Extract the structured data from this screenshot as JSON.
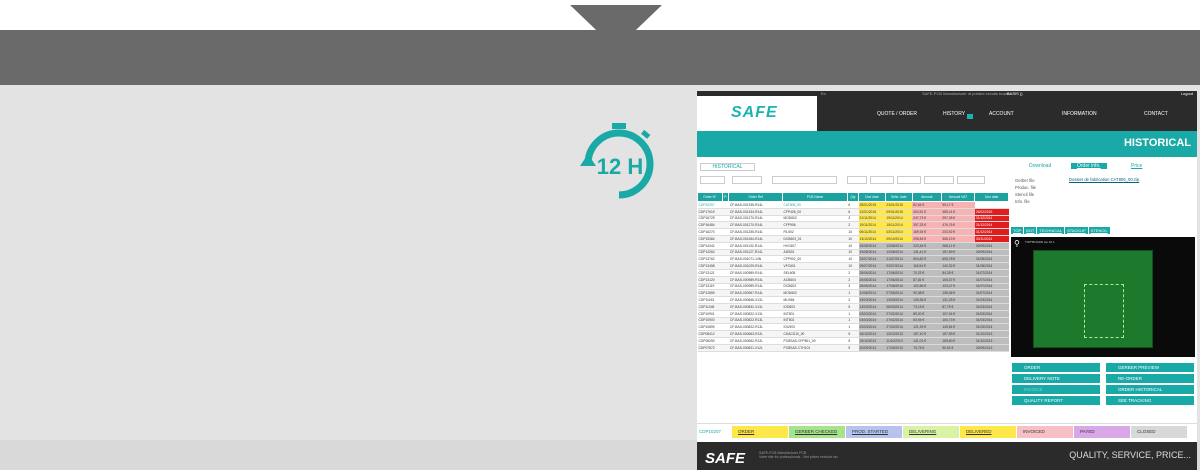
{
  "screenshot": {
    "lang": "En",
    "top_title": "SAFE-PCB Manufacturer of printed circuits board",
    "user": "BASIS ()",
    "logout": "Logout",
    "logo": "SAFE",
    "nav": [
      "QUOTE / ORDER",
      "HISTORY",
      "ACCOUNT",
      "INFORMATION",
      "CONTACT"
    ],
    "page_title": "HISTORICAL",
    "history_tab": "HISTORICAL",
    "columns": [
      "Order N°",
      "P.",
      "Order Ref",
      "PCB Name",
      "Qty",
      "Due date",
      "Sello. date",
      "Amount",
      "Amount VAT",
      "Due date"
    ],
    "rows": [
      [
        "CDP10207",
        "CF-BAS-001335-R14L",
        "CAT806_00",
        "6",
        "28/01/2015",
        "23/01/2015",
        "82,64 €",
        "99,17 €",
        ""
      ],
      [
        "CDP17619",
        "CF-BAS-001334-R14L",
        "CFP405_00",
        "6",
        "12/01/2015",
        "09/01/2015",
        "404,51 €",
        "485,41 €",
        "26/02/2015"
      ],
      [
        "CDP16729",
        "CF-BAS-001270-R14L",
        "MOD602",
        "3",
        "21/11/2014",
        "19/11/2014",
        "247,73 €",
        "297,28 €",
        "31/12/2014"
      ],
      [
        "CDP16484",
        "CF-BAS-001270-R14L",
        "CFP906",
        "2",
        "19/11/2014",
        "15/11/2014",
        "397,33 €",
        "476,76 €",
        "31/12/2014"
      ],
      [
        "CDP16270",
        "CF-BAS-001255-R14L",
        "FIL502",
        "10",
        "06/11/2014",
        "03/11/2014",
        "169,94 €",
        "203,92 €",
        "31/12/2014"
      ],
      [
        "CDP15384",
        "CF-BAS-001264-R14L",
        "DCB603_01",
        "10",
        "13/10/2014",
        "09/10/2014",
        "298,83 €",
        "358,19 €",
        "30/11/2014"
      ],
      [
        "CDP14342",
        "CF-BAS-001132-R14L",
        "HVC607",
        "10",
        "16/08/2014",
        "13/08/2014",
        "223,45 €",
        "268,11 €",
        "30/09/2014"
      ],
      [
        "CDP14264",
        "CF-BAS-001127-R14L",
        "AID501",
        "10",
        "19/08/2014",
        "13/08/2014",
        "131,41 €",
        "157,69 €",
        "30/09/2014"
      ],
      [
        "CDP13762",
        "CF-BAS-001071-14N",
        "CFP902_00",
        "10",
        "23/07/2014",
        "21/07/2014",
        "504,82 €",
        "605,78 €",
        "31/08/2014"
      ],
      [
        "CDP13458",
        "CF-BAS-001029-R14L",
        "VFC601",
        "10",
        "09/07/2014",
        "03/07/2014",
        "116,94 €",
        "140,32 €",
        "31/08/2014"
      ],
      [
        "CDP13121",
        "CF-BAS-000989-R14L",
        "SEL605",
        "2",
        "25/06/2014",
        "17/06/2014",
        "70,23 €",
        "84,28 €",
        "31/07/2014"
      ],
      [
        "CDP13120",
        "CF-BAS-000989-R14L",
        "ACB604",
        "2",
        "20/06/2014",
        "17/06/2014",
        "87,81 €",
        "105,37 €",
        "31/07/2014"
      ],
      [
        "CDP13119",
        "CF-BAS-000989-R14L",
        "DCB603",
        "3",
        "25/06/2014",
        "17/06/2014",
        "102,56 €",
        "123,07 €",
        "31/07/2014"
      ],
      [
        "CDP12859",
        "CF-BAS-000967-R14L",
        "MOD602",
        "1",
        "11/06/2014",
        "07/06/2014",
        "90,38 €",
        "108,46 €",
        "31/07/2014"
      ],
      [
        "CDP11163",
        "CF-BAS-000846-X13L",
        "MLI984",
        "2",
        "19/03/2014",
        "13/03/2014",
        "109,38 €",
        "131,25 €",
        "31/03/2014"
      ],
      [
        "CDP11045",
        "CF-BAS-000832-X13L",
        "IOD803",
        "5",
        "13/03/2014",
        "06/03/2014",
        "73,15 €",
        "87,78 €",
        "31/03/2014"
      ],
      [
        "CDP10901",
        "CF-BAS-000822-X13L",
        "INT801",
        "1",
        "03/03/2014",
        "27/02/2014",
        "89,20 €",
        "107,04 €",
        "31/03/2014"
      ],
      [
        "CDP10900",
        "CF-BAS-000822-R13L",
        "INT802",
        "1",
        "03/03/2014",
        "27/02/2014",
        "83,94 €",
        "100,73 €",
        "31/03/2014"
      ],
      [
        "CDP10899",
        "CF-BAS-000822-R13L",
        "IOU903",
        "1",
        "03/03/2014",
        "27/02/2014",
        "121,29 €",
        "145,54 €",
        "31/03/2014"
      ],
      [
        "CDP08412",
        "CF-BAS-000663-R12L",
        "CDACD10_00",
        "5",
        "16/10/2013",
        "13/10/2013",
        "157,10 €",
        "187,89 €",
        "31/10/2013"
      ],
      [
        "CDP08250",
        "CF-BAS-000652-R12L",
        "PCBSAS-CFP801_00",
        "5",
        "15/10/2013",
        "11/10/2013",
        "141,01 €",
        "169,60 €",
        "31/10/2013"
      ],
      [
        "CDP07872",
        "CF-BAS-000621-X12L",
        "PCBSAS-CTH101",
        "5",
        "20/09/2013",
        "17/09/2013",
        "75,75 €",
        "90,50 €",
        "30/09/2013"
      ]
    ],
    "right_tabs": [
      "Download",
      "Order info.",
      "Price"
    ],
    "file_labels": [
      "Gerber file",
      "Produc. file",
      "Stencil file",
      "Info. file"
    ],
    "gerber_link": "Dossier de fabrication CAT806_00.zip",
    "view_tabs": [
      "TOP",
      "BOT",
      "TECHNICAL",
      "STACKUP",
      "STENCIL"
    ],
    "pcb_label": "TOP*BOARD top 40 1",
    "buttons": [
      "ORDER",
      "GERBER PREVIEW",
      "DELIVERY NOTE",
      "RE-ORDER",
      "INVOICE",
      "ORDER HISTORICAL",
      "QUALITY REPORT",
      "SEE TRACKING"
    ],
    "status_order": "CDP10207",
    "status_steps": [
      "ORDER",
      "GERBER CHECKED",
      "PROD. STARTED",
      "DELIVERING",
      "DELIVERED",
      "INVOICED",
      "PAYED",
      "CLOSED"
    ],
    "footer_logo": "SAFE",
    "footer_text": "SAFE-PCB Manufacturer PCB",
    "footer_sub": "Votre site for professionals - Net prices exclude tax",
    "footer_slogan": "QUALITY, SERVICE, PRICE..."
  },
  "timer_text": "12 H",
  "colors": {
    "teal": "#19a9a6",
    "band": "#6a6a6a",
    "dark": "#2b2b2b"
  }
}
